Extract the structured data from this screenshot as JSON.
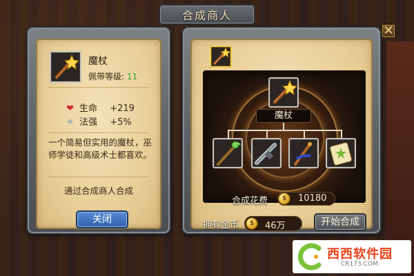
{
  "window": {
    "title": "合成商人",
    "close_icon": "close-icon"
  },
  "left_panel": {
    "item_name": "魔杖",
    "wear_level_label": "佩带等级:",
    "wear_level_value": "11",
    "stats": [
      {
        "icon": "heart-icon",
        "label": "生命",
        "value": "+219"
      },
      {
        "icon": "wand-small-icon",
        "label": "法强",
        "value": "+5%"
      }
    ],
    "description": "一个简易但实用的魔杖，巫师学徒和高级术士都喜欢。",
    "source": "通过合成商人合成",
    "close_button": "关闭"
  },
  "right_panel": {
    "result_name": "魔杖",
    "cost_label": "合成花费",
    "cost_value": "10180",
    "owned_label": "拥有金币",
    "owned_value": "46万",
    "start_button": "开始合成",
    "ingredients": [
      "green-staff-icon",
      "silver-gun-icon",
      "blue-staff-icon",
      "scroll-icon"
    ]
  },
  "watermark": {
    "brand": "西西软件园",
    "url": "CR173.COM"
  },
  "colors": {
    "gold": "#f1cc4d",
    "level_green": "#2aa62a",
    "button_blue": "#3a70c0"
  }
}
